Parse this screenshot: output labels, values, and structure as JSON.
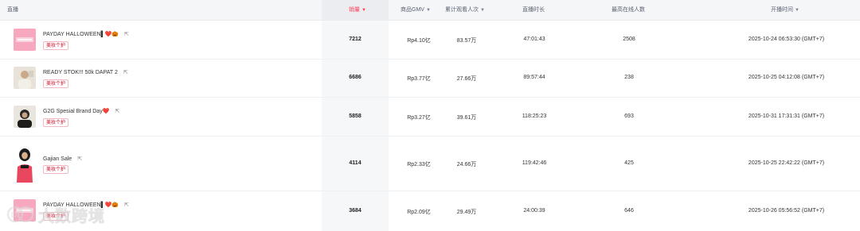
{
  "header": {
    "col_live": "直播",
    "col_sales": "销量",
    "col_gmv": "商品GMV",
    "col_viewers": "累计观看人次",
    "col_duration": "直播时长",
    "col_peak": "最高在线人数",
    "col_start": "开播时间",
    "sorted_column": "col_sales",
    "sort_caret": "▼"
  },
  "colors": {
    "accent": "#ff3d5a",
    "tag_text": "#d0021b",
    "header_bg": "#f5f6f8"
  },
  "rows": [
    {
      "title": "PAYDAY HALLOWEEN▌❤️🎃",
      "tag": "美妆个护",
      "sales": "7212",
      "gmv": "Rp4.10亿",
      "viewers": "83.57万",
      "duration": "47:01:43",
      "peak": "2508",
      "start": "2025-10-24 06:53:30 (GMT+7)",
      "thumb": "pink-banner"
    },
    {
      "title": "READY STOK!!! 50k DAPAT 2",
      "tag": "美妆个护",
      "sales": "6686",
      "gmv": "Rp3.77亿",
      "viewers": "27.66万",
      "duration": "89:57:44",
      "peak": "238",
      "start": "2025-10-25 04:12:08 (GMT+7)",
      "thumb": "person-light"
    },
    {
      "title": "G2G Spesial Brand Day❤️",
      "tag": "美妆个护",
      "sales": "5858",
      "gmv": "Rp3.27亿",
      "viewers": "39.61万",
      "duration": "118:25:23",
      "peak": "693",
      "start": "2025-10-31 17:31:31 (GMT+7)",
      "thumb": "person-dark"
    },
    {
      "title": "Gajian Sale",
      "tag": "美妆个护",
      "sales": "4114",
      "gmv": "Rp2.33亿",
      "viewers": "24.66万",
      "duration": "119:42:46",
      "peak": "425",
      "start": "2025-10-25 22:42:22 (GMT+7)",
      "thumb": "person-hijab"
    },
    {
      "title": "PAYDAY HALLOWEEN▌❤️🎃",
      "tag": "美妆个护",
      "sales": "3684",
      "gmv": "Rp2.09亿",
      "viewers": "29.49万",
      "duration": "24:00:39",
      "peak": "646",
      "start": "2025-10-26 05:56:52 (GMT+7)",
      "thumb": "pink-banner"
    }
  ],
  "icons": {
    "link": "⇱",
    "watermark_logo": "brand-logo-icon"
  },
  "watermark": {
    "text": "大数跨境"
  }
}
